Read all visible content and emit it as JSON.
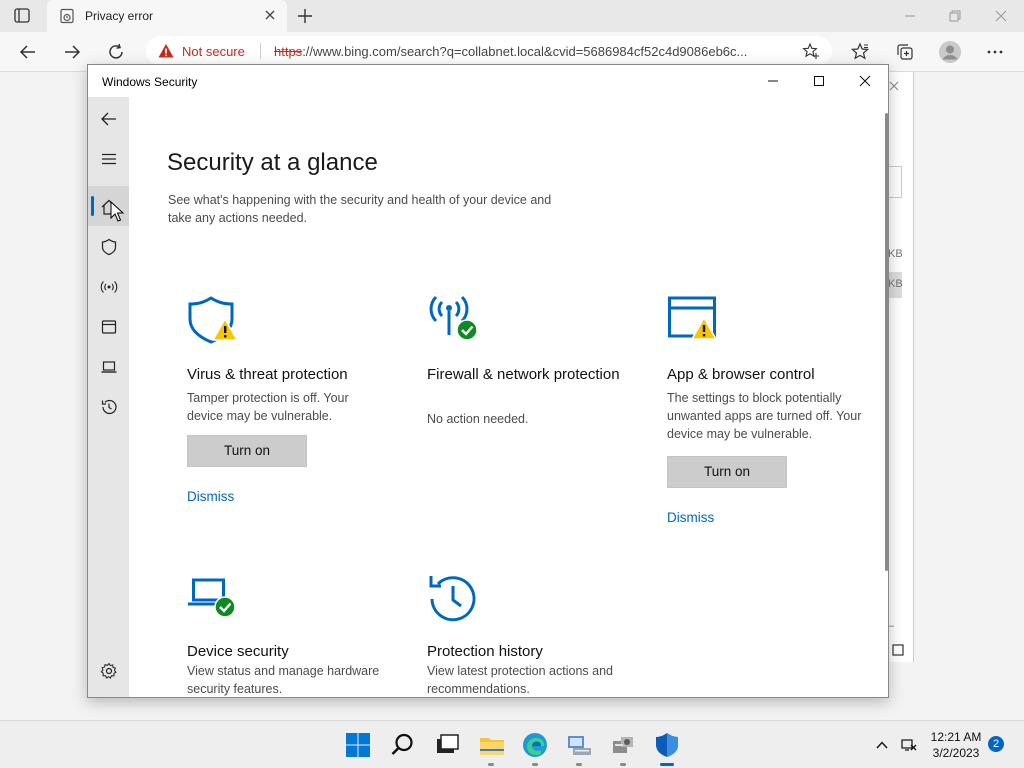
{
  "browser": {
    "tab_title": "Privacy error",
    "not_secure_label": "Not secure",
    "url_scheme": "https",
    "url_rest": "://www.bing.com/search?q=collabnet.local&cvid=5686984cf52c4d9086eb6c..."
  },
  "background_page": {
    "size_label_1": "KB",
    "size_label_2": "KB",
    "dash": "–"
  },
  "security_window": {
    "title": "Windows Security",
    "heading": "Security at a glance",
    "subheading": "See what's happening with the security and health of your device and take any actions needed.",
    "cards": [
      {
        "title": "Virus & threat protection",
        "desc": "Tamper protection is off. Your device may be vulnerable.",
        "button": "Turn on",
        "dismiss": "Dismiss",
        "icon": "shield-warning-icon"
      },
      {
        "title": "Firewall & network protection",
        "desc": "No action needed.",
        "icon": "firewall-ok-icon"
      },
      {
        "title": "App & browser control",
        "desc": "The settings to block potentially unwanted apps are turned off. Your device may be vulnerable.",
        "button": "Turn on",
        "dismiss": "Dismiss",
        "icon": "app-browser-warning-icon"
      },
      {
        "title": "Device security",
        "desc": "View status and manage hardware security features.",
        "icon": "device-ok-icon"
      },
      {
        "title": "Protection history",
        "desc": "View latest protection actions and recommendations.",
        "icon": "history-icon"
      }
    ]
  },
  "taskbar": {
    "time": "12:21 AM",
    "date": "3/2/2023",
    "notification_count": "2"
  },
  "colors": {
    "accent": "#0067c0",
    "warning": "#f8c600",
    "ok": "#0f8a24",
    "error": "#c42b1c"
  }
}
